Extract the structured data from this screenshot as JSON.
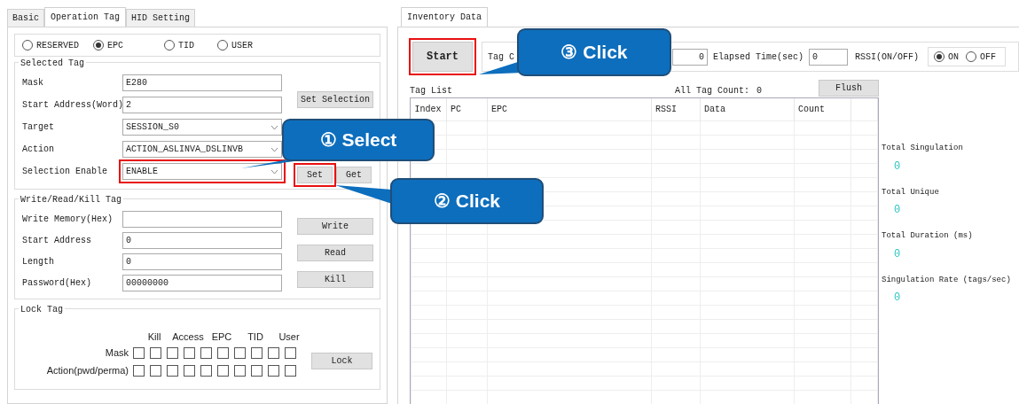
{
  "tabs": [
    {
      "label": "Basic",
      "selected": false
    },
    {
      "label": "Operation Tag",
      "selected": true
    },
    {
      "label": "HID Setting",
      "selected": false
    }
  ],
  "memory_bank": [
    {
      "label": "RESERVED",
      "selected": false
    },
    {
      "label": "EPC",
      "selected": true
    },
    {
      "label": "TID",
      "selected": false
    },
    {
      "label": "USER",
      "selected": false
    }
  ],
  "selected_tag": {
    "title": "Selected Tag",
    "fields": [
      {
        "label": "Mask",
        "kind": "text",
        "value": "E280",
        "highlighted": false
      },
      {
        "label": "Start Address(Word)",
        "kind": "text",
        "value": "2",
        "highlighted": false
      },
      {
        "label": "Target",
        "kind": "select",
        "value": "SESSION_S0",
        "highlighted": false
      },
      {
        "label": "Action",
        "kind": "select",
        "value": "ACTION_ASLINVA_DSLINVB",
        "highlighted": false
      },
      {
        "label": "Selection Enable",
        "kind": "select",
        "value": "ENABLE",
        "highlighted": true
      }
    ],
    "set_selection_button": "Set Selection",
    "set_button": {
      "label": "Set",
      "highlighted": true
    },
    "get_button": {
      "label": "Get",
      "highlighted": false
    }
  },
  "write_read_kill": {
    "title": "Write/Read/Kill Tag",
    "fields": [
      {
        "label": "Write Memory(Hex)"
      },
      {
        "label": "Start Address",
        "value": "0"
      },
      {
        "label": "Length",
        "value": "0"
      },
      {
        "label": "Password(Hex)",
        "value": "00000000"
      }
    ],
    "buttons": [
      "Write",
      "Read",
      "Kill"
    ]
  },
  "lock_tag": {
    "title": "Lock Tag",
    "columns": [
      "Kill",
      "Access",
      "EPC",
      "TID",
      "User"
    ],
    "rows": [
      {
        "label": "Mask",
        "checks": [
          false,
          false,
          false,
          false,
          false,
          false,
          false,
          false,
          false,
          false
        ]
      },
      {
        "label": "Action(pwd/perma)",
        "checks": [
          false,
          false,
          false,
          false,
          false,
          false,
          false,
          false,
          false,
          false
        ]
      }
    ],
    "button": "Lock"
  },
  "inventory": {
    "tabs": [
      {
        "label": "Inventory Data",
        "selected": true
      }
    ],
    "start_button": {
      "label": "Start",
      "highlighted": true
    },
    "tag_count_label": "Tag C",
    "tag_count_value": "0",
    "elapsed_label": "Elapsed Time(sec)",
    "elapsed_value": "0",
    "rssi_label": "RSSI(ON/OFF)",
    "rssi_options": [
      {
        "label": "ON",
        "selected": true
      },
      {
        "label": "OFF",
        "selected": false
      }
    ],
    "tag_list_title": "Tag List",
    "all_tag_count_label": "All Tag Count:",
    "all_tag_count_value": "0",
    "flush_button": "Flush",
    "table": {
      "columns": [
        "Index",
        "PC",
        "EPC",
        "RSSI",
        "Data",
        "Count"
      ]
    }
  },
  "stats": [
    {
      "label": "Total Singulation",
      "value": "0"
    },
    {
      "label": "Total Unique",
      "value": "0"
    },
    {
      "label": "Total Duration (ms)",
      "value": "0"
    },
    {
      "label": "Singulation Rate (tags/sec)",
      "value": "0"
    }
  ],
  "callouts": [
    {
      "label": "① Select"
    },
    {
      "label": "② Click"
    },
    {
      "label": "③ Click"
    }
  ]
}
